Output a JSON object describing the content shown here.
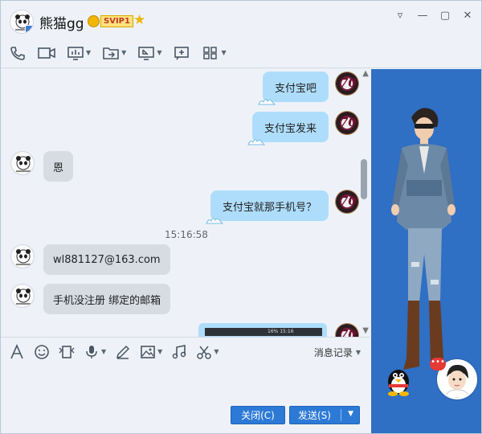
{
  "window": {
    "contact_name": "熊猫gg",
    "vip_label": "SVIP1",
    "controls": {
      "pin": "▿",
      "minimize": "—",
      "maximize": "▢",
      "close": "✕"
    }
  },
  "toolbar": {
    "icons": [
      "phone-icon",
      "video-call-icon",
      "screen-share-icon",
      "file-transfer-icon",
      "remote-assist-icon",
      "whiteboard-icon",
      "apps-grid-icon"
    ]
  },
  "chat": {
    "messages": [
      {
        "side": "right",
        "text": "支付宝吧"
      },
      {
        "side": "right",
        "text": "支付宝发来"
      },
      {
        "side": "left",
        "text": "恩"
      },
      {
        "side": "right",
        "text": "支付宝就那手机号？"
      },
      {
        "side": "left",
        "text": "wl881127@163.com"
      },
      {
        "side": "left",
        "text": "手机没注册 绑定的邮箱"
      }
    ],
    "timestamp": "15:16:58",
    "image_strip_text": "16% 15:16"
  },
  "input_toolbar": {
    "history_label": "消息记录"
  },
  "buttons": {
    "close_label": "关闭(C)",
    "send_label": "发送(S)"
  },
  "side_panel": {
    "notification_dots": "•••"
  },
  "colors": {
    "accent": "#2c7ad6",
    "bubble_self": "#aeddfb",
    "bubble_other": "#d7dce3",
    "side_panel": "#2f6fc4"
  }
}
